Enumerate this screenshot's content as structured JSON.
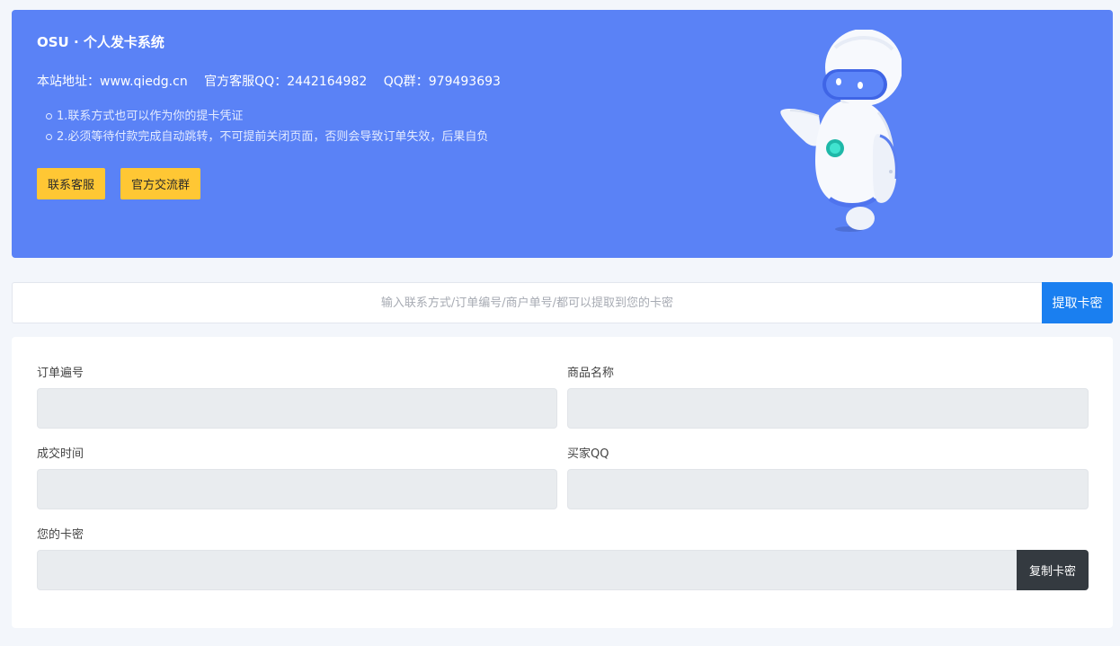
{
  "hero": {
    "title": "OSU · 个人发卡系统",
    "site_address": "本站地址：www.qiedg.cn",
    "service_qq": "官方客服QQ：2442164982",
    "qq_group": "QQ群：979493693",
    "tips": [
      "1.联系方式也可以作为你的提卡凭证",
      "2.必须等待付款完成自动跳转，不可提前关闭页面，否则会导致订单失效，后果自负"
    ],
    "buttons": {
      "contact": "联系客服",
      "group": "官方交流群"
    },
    "colors": {
      "background": "#5a82f6",
      "button": "#ffc734"
    }
  },
  "search": {
    "placeholder": "输入联系方式/订单编号/商户单号/都可以提取到您的卡密",
    "value": "",
    "button": "提取卡密",
    "button_color": "#1a7ff0"
  },
  "order": {
    "order_no": {
      "label": "订单遍号",
      "value": ""
    },
    "product_name": {
      "label": "商品名称",
      "value": ""
    },
    "deal_time": {
      "label": "成交时间",
      "value": ""
    },
    "buyer_qq": {
      "label": "买家QQ",
      "value": ""
    },
    "card_secret": {
      "label": "您的卡密",
      "value": ""
    },
    "copy_button": "复制卡密"
  }
}
